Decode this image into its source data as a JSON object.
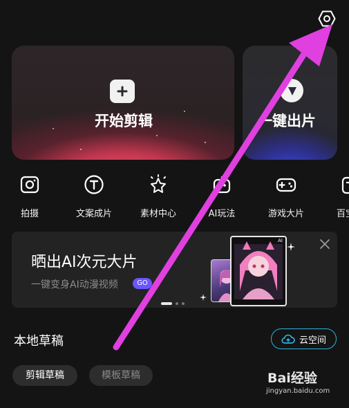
{
  "hero": {
    "edit_label": "开始剪辑",
    "oneclick_label": "一键出片"
  },
  "tools": [
    {
      "label": "拍摄",
      "icon": "camera-icon"
    },
    {
      "label": "文案成片",
      "icon": "text-t-icon"
    },
    {
      "label": "素材中心",
      "icon": "sparkle-star-icon"
    },
    {
      "label": "AI玩法",
      "icon": "ai-robot-icon"
    },
    {
      "label": "游戏大片",
      "icon": "gamepad-icon"
    },
    {
      "label": "百宝",
      "icon": "toolbox-icon"
    }
  ],
  "banner": {
    "title": "晒出AI次元大片",
    "subtitle": "一键变身AI动漫视频",
    "badge": "GO",
    "card_tag": "AI"
  },
  "drafts": {
    "title": "本地草稿",
    "cloud_label": "云空间",
    "tabs": [
      "剪辑草稿",
      "模板草稿"
    ]
  },
  "watermark": {
    "brand": "Bai经验",
    "url": "jingyan.baidu.com"
  },
  "colors": {
    "background": "#141414",
    "arrow": "#e040e0",
    "cloud_border": "#2fb3e0",
    "go_badge": "#6b55ff"
  }
}
